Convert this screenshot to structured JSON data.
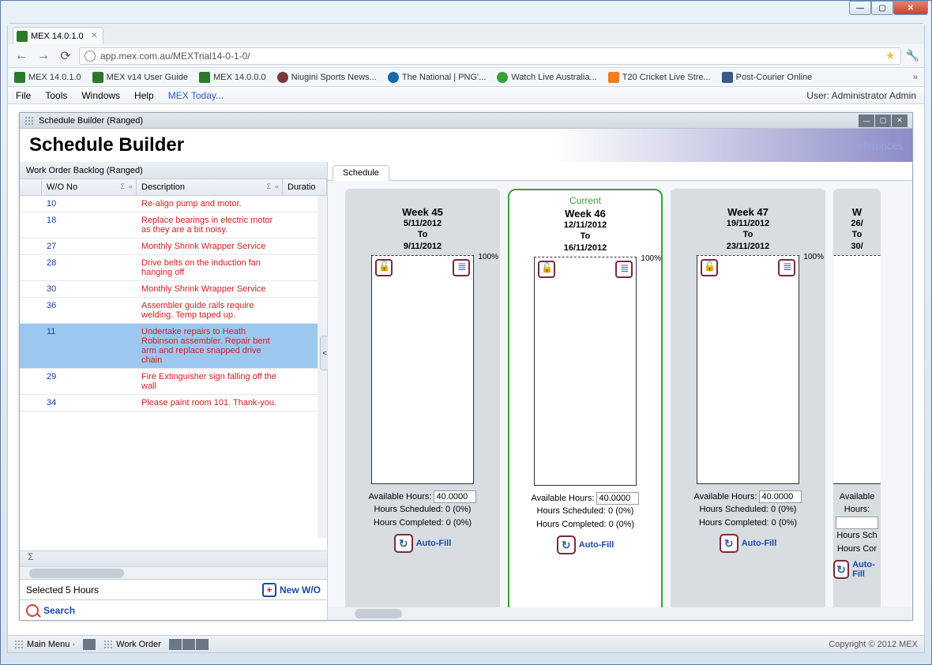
{
  "browser": {
    "tab_title": "MEX 14.0.1.0",
    "url": "app.mex.com.au/MEXTrial14-0-1-0/",
    "bookmarks": [
      {
        "label": "MEX 14.0.1.0",
        "icon": "green"
      },
      {
        "label": "MEX v14 User Guide",
        "icon": "green"
      },
      {
        "label": "MEX 14.0.0.0",
        "icon": "green"
      },
      {
        "label": "Niugini Sports News...",
        "icon": "png"
      },
      {
        "label": "The National | PNG'...",
        "icon": "drupal"
      },
      {
        "label": "Watch Live Australia...",
        "icon": "greenball"
      },
      {
        "label": "T20 Cricket Live Stre...",
        "icon": "blogger"
      },
      {
        "label": "Post-Courier Online",
        "icon": "pc"
      }
    ]
  },
  "menubar": {
    "items": [
      "File",
      "Tools",
      "Windows",
      "Help"
    ],
    "today": "MEX Today...",
    "user": "User: Administrator Admin"
  },
  "subwindow": {
    "title": "Schedule Builder (Ranged)"
  },
  "header": {
    "title": "Schedule Builder",
    "prefs": "Preferences"
  },
  "backlog": {
    "panel_title": "Work Order Backlog (Ranged)",
    "columns": [
      "",
      "W/O No",
      "Description",
      "Duratio"
    ],
    "rows": [
      {
        "no": "10",
        "desc": "Re-align pump and motor."
      },
      {
        "no": "18",
        "desc": "Replace bearings in electric motor as they are a bit noisy."
      },
      {
        "no": "27",
        "desc": "Monthly Shrink Wrapper Service"
      },
      {
        "no": "28",
        "desc": "Drive belts on the induction fan hanging off"
      },
      {
        "no": "30",
        "desc": "Monthly Shrink Wrapper Service"
      },
      {
        "no": "36",
        "desc": "Assembler guide rails require welding.  Temp taped up."
      },
      {
        "no": "11",
        "desc": "Undertake repairs to Heath Robinson assembler.  Repair bent arm and replace snapped drive chain",
        "sel": true
      },
      {
        "no": "29",
        "desc": "Fire Extinguisher sign falling off the wall"
      },
      {
        "no": "34",
        "desc": "Please paint room 101.  Thank-you."
      }
    ],
    "selected": "Selected 5 Hours",
    "newwo": "New W/O",
    "search": "Search"
  },
  "schedule": {
    "tab": "Schedule",
    "avail_label": "Available Hours:",
    "sched_label": "Hours Scheduled: 0 (0%)",
    "comp_label": "Hours Completed: 0 (0%)",
    "autofill": "Auto-Fill",
    "weeks": [
      {
        "title": "Week 45",
        "from": "5/11/2012",
        "to": "9/11/2012",
        "hours": "40.0000",
        "pct": "100%",
        "current": false
      },
      {
        "title": "Week 46",
        "from": "12/11/2012",
        "to": "16/11/2012",
        "hours": "40.0000",
        "pct": "100%",
        "current": true
      },
      {
        "title": "Week 47",
        "from": "19/11/2012",
        "to": "23/11/2012",
        "hours": "40.0000",
        "pct": "100%",
        "current": false
      },
      {
        "title": "W",
        "from": "26/",
        "to": "30/",
        "hours": "",
        "pct": "",
        "current": false,
        "partial": true
      }
    ],
    "current_label": "Current"
  },
  "taskbar": {
    "main": "Main Menu ·",
    "wo": "Work Order",
    "copyright": "Copyright © 2012 MEX"
  }
}
